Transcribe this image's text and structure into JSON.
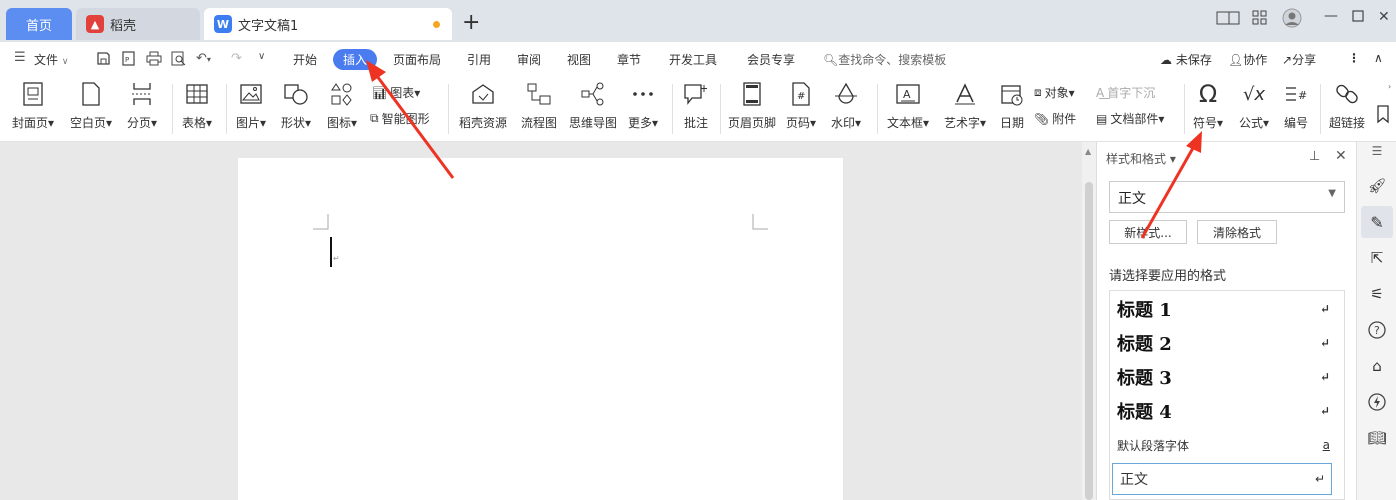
{
  "tabs": {
    "home": "首页",
    "daoke": "稻壳",
    "doc": "文字文稿1",
    "add": "+"
  },
  "menubar": {
    "file": "文件",
    "items": [
      "开始",
      "插入",
      "页面布局",
      "引用",
      "审阅",
      "视图",
      "章节",
      "开发工具",
      "会员专享"
    ],
    "search": "查找命令、搜索模板",
    "unsaved": "未保存",
    "collab": "协作",
    "share": "分享"
  },
  "ribbon": {
    "cover": "封面页",
    "blank": "空白页",
    "pagebreak": "分页",
    "table": "表格",
    "picture": "图片",
    "shape": "形状",
    "icon": "图标",
    "chart": "图表",
    "smartart": "智能图形",
    "daoke_res": "稻壳资源",
    "flowchart": "流程图",
    "mindmap": "思维导图",
    "more": "更多",
    "comment": "批注",
    "header_footer": "页眉页脚",
    "page_num": "页码",
    "watermark": "水印",
    "textbox": "文本框",
    "wordart": "艺术字",
    "date": "日期",
    "object": "对象",
    "attachment": "附件",
    "dropcap": "首字下沉",
    "docpart": "文档部件",
    "symbol": "符号",
    "formula": "公式",
    "numbering": "编号",
    "hyperlink": "超链接"
  },
  "panel": {
    "title": "样式和格式",
    "current_style": "正文",
    "new_style": "新样式...",
    "clear_format": "清除格式",
    "prompt": "请选择要应用的格式",
    "styles": [
      {
        "label": "标题  1",
        "mark": "↵"
      },
      {
        "label": "标题  2",
        "mark": "↵"
      },
      {
        "label": "标题  3",
        "mark": "↵"
      },
      {
        "label": "标题  4",
        "mark": "↵"
      },
      {
        "label": "默认段落字体",
        "mark": "a"
      },
      {
        "label": "正文",
        "mark": "↵"
      }
    ]
  },
  "colors": {
    "accent": "#4a7cf0",
    "arrow": "#ee3322"
  }
}
